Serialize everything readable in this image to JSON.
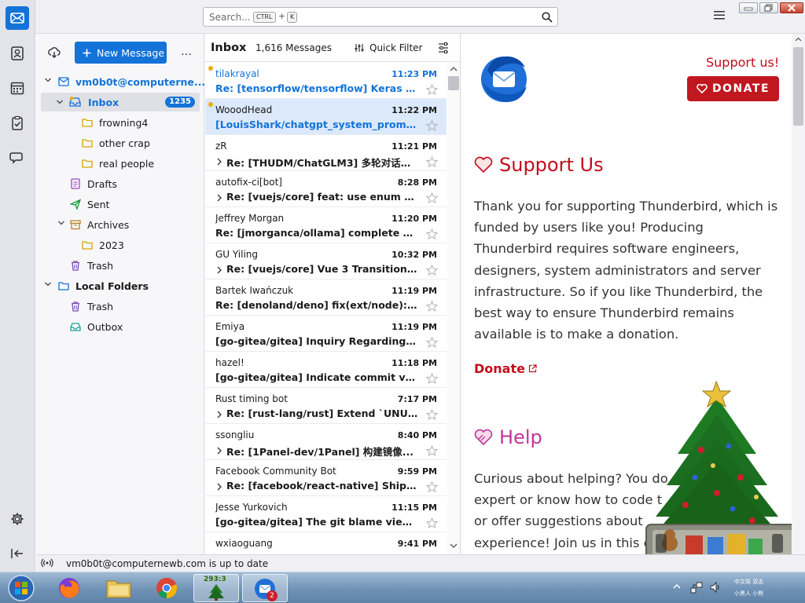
{
  "search": {
    "placeholder": "Search...",
    "key1": "CTRL",
    "plus": "+",
    "key2": "K"
  },
  "spaces": {
    "icons": [
      "mail-icon",
      "address-book-icon",
      "calendar-icon",
      "tasks-icon",
      "chat-icon",
      "settings-icon",
      "collapse-icon"
    ]
  },
  "folders": {
    "new_message": "New Message",
    "more": "…",
    "account": "vm0b0t@computerne...",
    "inbox": "Inbox",
    "inbox_count": "1235",
    "items": [
      {
        "label": "frowning4"
      },
      {
        "label": "other crap"
      },
      {
        "label": "real people"
      },
      {
        "label": "Drafts"
      },
      {
        "label": "Sent"
      },
      {
        "label": "Archives"
      },
      {
        "label": "2023"
      },
      {
        "label": "Trash"
      }
    ],
    "local_folders": "Local Folders",
    "local_trash": "Trash",
    "outbox": "Outbox"
  },
  "list": {
    "title": "Inbox",
    "count": "1,616 Messages",
    "quick_filter": "Quick Filter",
    "messages": [
      {
        "from": "tilakrayal",
        "time": "11:23 PM",
        "subject": "Re: [tensorflow/tensorflow] Keras n...",
        "unread": true,
        "thread": false
      },
      {
        "from": "WooodHead",
        "time": "11:22 PM",
        "subject": "[LouisShark/chatgpt_system_prompt...",
        "unread": false,
        "thread": false
      },
      {
        "from": "zR",
        "time": "11:21 PM",
        "subject": "Re: [THUDM/ChatGLM3] 多轮对话的...",
        "unread": false,
        "thread": true
      },
      {
        "from": "autofix-ci[bot]",
        "time": "8:28 PM",
        "subject": "Re: [vuejs/core] feat: use enum to...",
        "unread": false,
        "thread": true
      },
      {
        "from": "Jeffrey Morgan",
        "time": "11:20 PM",
        "subject": "Re: [jmorganca/ollama] complete ggu...",
        "unread": false,
        "thread": false
      },
      {
        "from": "GU Yiling",
        "time": "10:32 PM",
        "subject": "Re: [vuejs/core] Vue 3 Transition ...",
        "unread": false,
        "thread": true
      },
      {
        "from": "Bartek Iwańczuk",
        "time": "11:19 PM",
        "subject": "Re: [denoland/deno] fix(ext/node): a...",
        "unread": false,
        "thread": false
      },
      {
        "from": "Emiya",
        "time": "11:19 PM",
        "subject": "[go-gitea/gitea] Inquiry Regarding \"b...",
        "unread": false,
        "thread": false
      },
      {
        "from": "hazel!",
        "time": "11:18 PM",
        "subject": "[go-gitea/gitea] Indicate commit veri...",
        "unread": false,
        "thread": false
      },
      {
        "from": "Rust timing bot",
        "time": "7:17 PM",
        "subject": "Re: [rust-lang/rust] Extend `UNUSE...",
        "unread": false,
        "thread": true
      },
      {
        "from": "ssongliu",
        "time": "8:40 PM",
        "subject": "Re: [1Panel-dev/1Panel] 构建镜像...",
        "unread": false,
        "thread": true
      },
      {
        "from": "Facebook Community Bot",
        "time": "9:59 PM",
        "subject": "Re: [facebook/react-native] Ship \"...",
        "unread": false,
        "thread": true
      },
      {
        "from": "Jesse Yurkovich",
        "time": "11:15 PM",
        "subject": "[go-gitea/gitea] The git blame view f...",
        "unread": false,
        "thread": false
      },
      {
        "from": "wxiaoguang",
        "time": "9:41 PM",
        "subject": "",
        "unread": false,
        "thread": false
      }
    ]
  },
  "content": {
    "support_link": "Support us!",
    "donate_button": "DONATE",
    "support_heading": "Support Us",
    "support_text": "Thank you for supporting Thunderbird, which is funded by users like you! Producing Thunderbird requires software administrators and server infrastructure. So if you like Thunderbird, the best way to ensure Thunderbird remains available is to make a donation.",
    "support_text_html_lines": [
      "Thank you for supporting Thunderbird, which is",
      "funded by users like you! Producing",
      "Thunderbird requires software engineers,",
      "designers, system administrators and server",
      "infrastructure. So if you like Thunderbird, the",
      "best way to ensure Thunderbird remains",
      "available is to make a donation."
    ],
    "donate_link": "Donate",
    "help_heading": "Help",
    "help_lines": [
      "Curious about helping? You do",
      "expert or know how to code t",
      "or offer suggestions about",
      "experience! Join us in this c"
    ]
  },
  "status": {
    "text": "vm0b0t@computernewb.com is up to date"
  },
  "taskbar": {
    "tree_counter": "293:3",
    "thunderbird_badge": "2",
    "tray_line1": "中文简 双击",
    "tray_line2": "小黑人 小熊"
  },
  "colors": {
    "accent": "#1373d9",
    "donate_red": "#c1171f",
    "help_pink": "#c0369a"
  }
}
